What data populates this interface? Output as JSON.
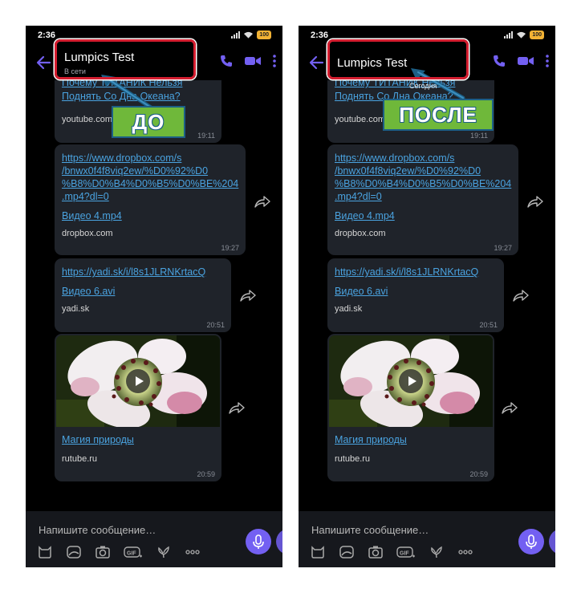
{
  "status_bar": {
    "time": "2:36",
    "battery": "100"
  },
  "before": {
    "contact_name": "Lumpics Test",
    "contact_status": "В сети",
    "callout": "ДО"
  },
  "after": {
    "contact_name": "Lumpics Test",
    "today_label": "Сегодня",
    "callout": "ПОСЛЕ"
  },
  "messages": {
    "m1": {
      "title_line1": "Почему ТИТАНИК Нельзя",
      "title_line2": "Поднять Со Дна Океана?",
      "domain": "youtube.com",
      "time": "19:11"
    },
    "m2": {
      "url_lines": [
        "https://www.dropbox.com/s",
        "/bnwx0f4f8viq2ew/%D0%92%D0",
        "%B8%D0%B4%D0%B5%D0%BE%204",
        ".mp4?dl=0"
      ],
      "title": "Видео 4.mp4",
      "domain": "dropbox.com",
      "time": "19:27"
    },
    "m3": {
      "url": "https://yadi.sk/i/l8s1JLRNKrtacQ",
      "title": "Видео 6.avi",
      "domain": "yadi.sk",
      "time": "20:51"
    },
    "m4": {
      "title": "Магия природы",
      "domain": "rutube.ru",
      "time": "20:59"
    }
  },
  "input": {
    "placeholder": "Напишите сообщение…"
  },
  "colors": {
    "accent": "#7360f2",
    "link": "#4aa3e0",
    "bubble": "#1f232a",
    "highlight": "#d51e30",
    "callout": "#6fb83a"
  }
}
